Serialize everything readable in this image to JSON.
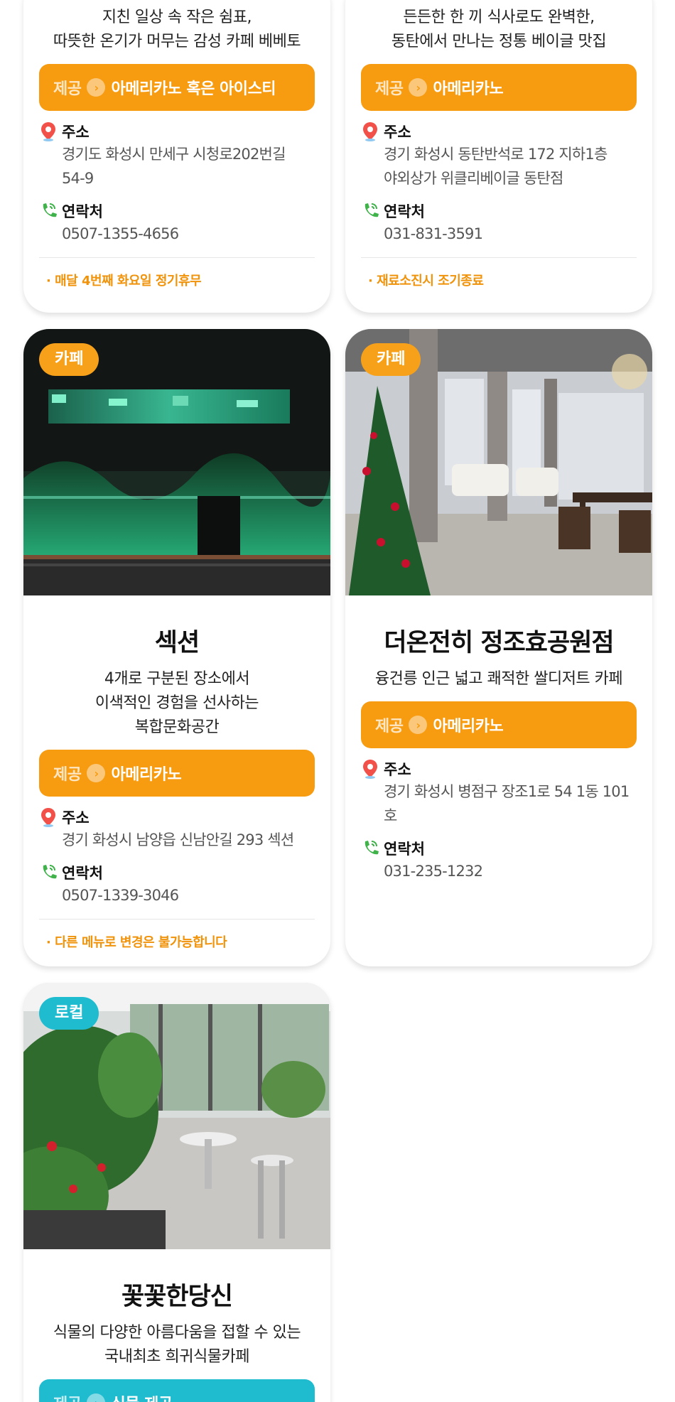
{
  "cards": [
    {
      "desc": [
        "지친 일상 속 작은 쉼표,",
        "따뜻한 온기가 머무는 감성 카페 베베토"
      ],
      "offer_tag": "제공",
      "offer": "아메리카노 혹은 아이스티",
      "address_label": "주소",
      "address": [
        "경기도 화성시 만세구 시청로202번길",
        "54-9"
      ],
      "contact_label": "연락처",
      "phone": "0507-1355-4656",
      "note": "· 매달 4번째 화요일 정기휴무"
    },
    {
      "desc": [
        "든든한 한 끼 식사로도 완벽한,",
        "동탄에서 만나는 정통 베이글 맛집"
      ],
      "offer_tag": "제공",
      "offer": "아메리카노",
      "address_label": "주소",
      "address": [
        "경기 화성시 동탄반석로 172 지하1층",
        "야외상가 위클리베이글 동탄점"
      ],
      "contact_label": "연락처",
      "phone": "031-831-3591",
      "note": "· 재료소진시 조기종료"
    },
    {
      "badge": "카페",
      "title": "섹션",
      "desc": [
        "4개로 구분된 장소에서",
        "이색적인 경험을 선사하는",
        "복합문화공간"
      ],
      "offer_tag": "제공",
      "offer": "아메리카노",
      "address_label": "주소",
      "address": [
        "경기 화성시 남양읍 신남안길 293 섹션"
      ],
      "contact_label": "연락처",
      "phone": "0507-1339-3046",
      "note": "· 다른 메뉴로 변경은 불가능합니다"
    },
    {
      "badge": "카페",
      "title": "더온전히 정조효공원점",
      "desc": [
        "융건릉 인근 넓고 쾌적한 쌀디저트 카페"
      ],
      "offer_tag": "제공",
      "offer": "아메리카노",
      "address_label": "주소",
      "address": [
        "경기 화성시 병점구 장조1로 54 1동 101호"
      ],
      "contact_label": "연락처",
      "phone": "031-235-1232"
    },
    {
      "badge": "로컬",
      "title": "꽃꽃한당신",
      "desc": [
        "식물의 다양한 아름다움을 접할 수 있는",
        "국내최초 희귀식물카페"
      ],
      "offer_tag": "제공",
      "offer": "식물 제공"
    }
  ],
  "colors": {
    "orange": "#f79b10",
    "teal": "#1fbcd0",
    "note": "#f0930a"
  },
  "icons": {
    "address": "map-pin-icon",
    "contact": "phone-icon",
    "offer": "chevron-right-icon"
  }
}
